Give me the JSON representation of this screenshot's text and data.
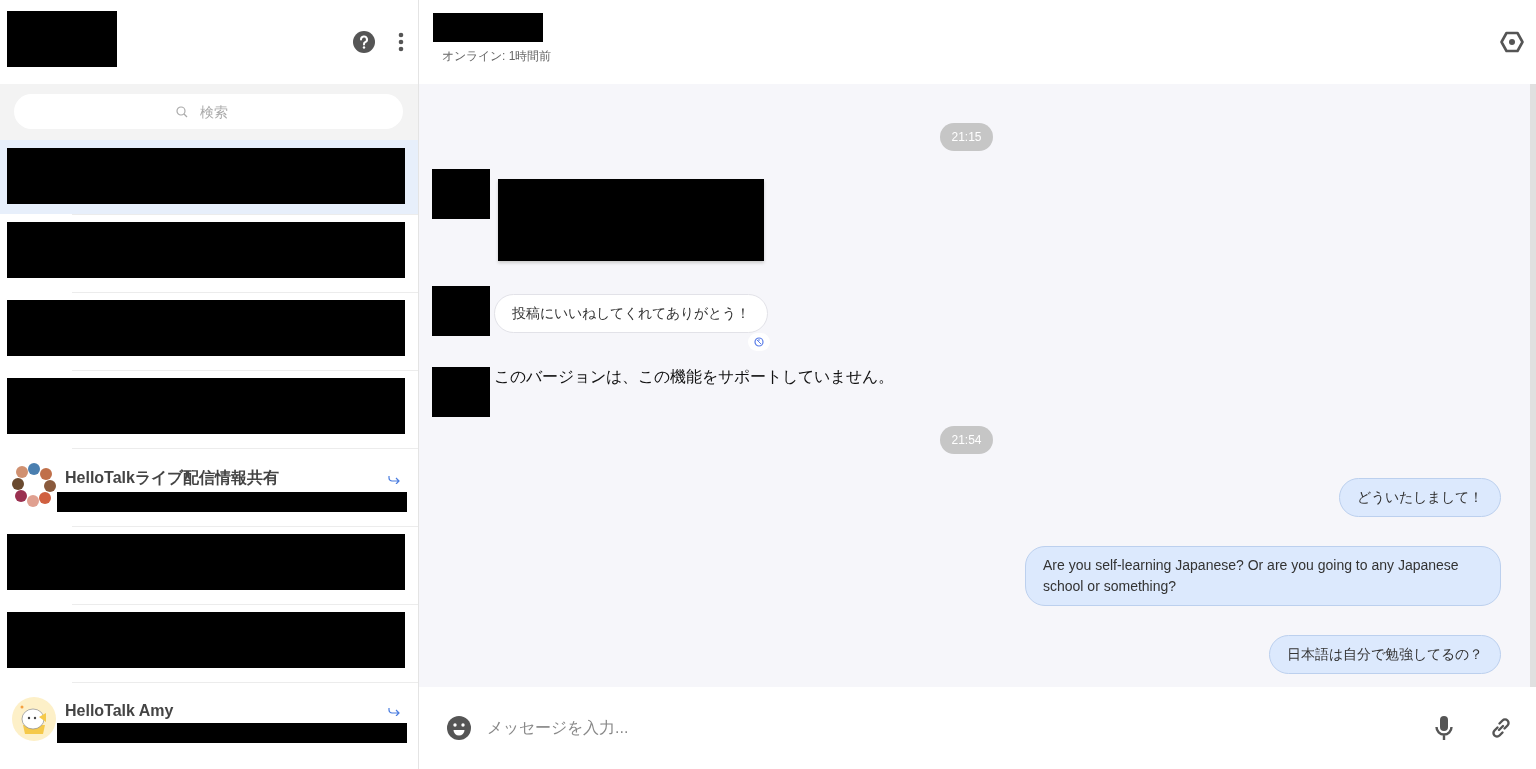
{
  "sidebar": {
    "search": {
      "placeholder": "検索"
    },
    "conversations": [
      {
        "kind": "redacted",
        "selected": true
      },
      {
        "kind": "redacted",
        "selected": false
      },
      {
        "kind": "redacted",
        "selected": false
      },
      {
        "kind": "redacted",
        "selected": false
      },
      {
        "kind": "named",
        "name": "HelloTalkライブ配信情報共有",
        "selected": false
      },
      {
        "kind": "redacted",
        "selected": false
      },
      {
        "kind": "redacted",
        "selected": false
      },
      {
        "kind": "named",
        "avatar": {
          "kind": "mascot"
        },
        "name": "HelloTalk Amy",
        "selected": false
      }
    ]
  },
  "chat": {
    "status": "オンライン: 1時間前",
    "messages": [
      {
        "kind": "time",
        "text": "21:15"
      },
      {
        "kind": "incoming_redacted"
      },
      {
        "kind": "incoming",
        "text": "投稿にいいねしてくれてありがとう！",
        "translate": true
      },
      {
        "kind": "notice",
        "text": "このバージョンは、この機能をサポートしていません。"
      },
      {
        "kind": "time",
        "text": "21:54"
      },
      {
        "kind": "outgoing",
        "text": "どういたしまして！"
      },
      {
        "kind": "outgoing",
        "text": "Are you self-learning Japanese? Or are you going to any Japanese school or something?"
      },
      {
        "kind": "outgoing",
        "text": "日本語は自分で勉強してるの？"
      }
    ],
    "input": {
      "placeholder": "メッセージを入力..."
    }
  }
}
